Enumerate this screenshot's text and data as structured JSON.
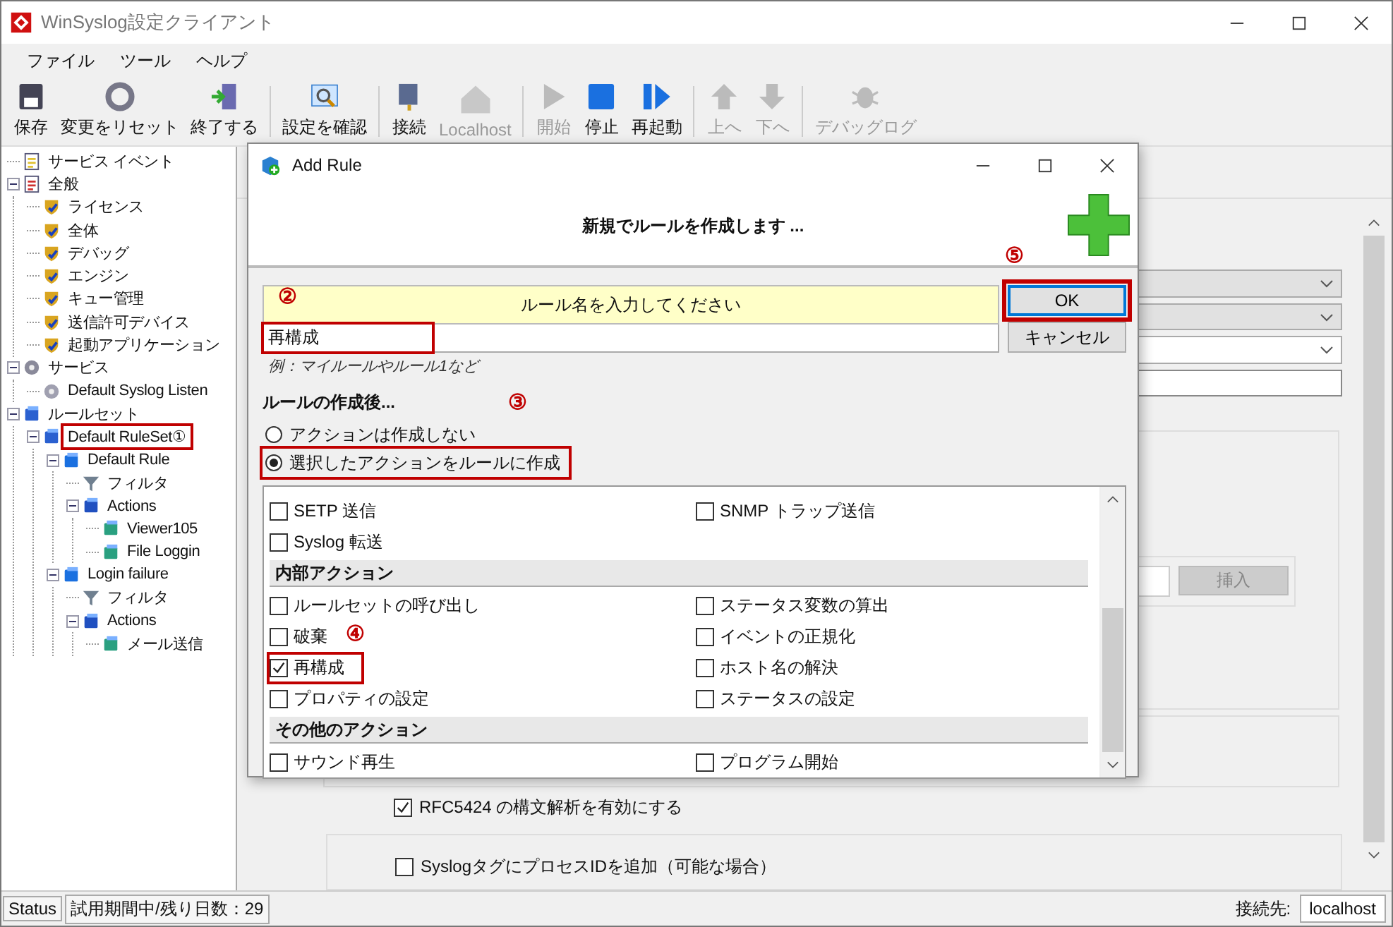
{
  "window": {
    "title": "WinSyslog設定クライアント"
  },
  "menu": [
    "ファイル",
    "ツール",
    "ヘルプ"
  ],
  "toolbar": [
    {
      "buttons": [
        {
          "label": "保存",
          "disabled": false
        },
        {
          "label": "変更をリセット",
          "disabled": false
        },
        {
          "label": "終了する",
          "disabled": false
        }
      ]
    },
    {
      "buttons": [
        {
          "label": "設定を確認",
          "disabled": false
        }
      ]
    },
    {
      "buttons": [
        {
          "label": "接続",
          "disabled": false
        },
        {
          "label": "Localhost",
          "disabled": true
        }
      ]
    },
    {
      "buttons": [
        {
          "label": "開始",
          "disabled": true
        },
        {
          "label": "停止",
          "disabled": false
        },
        {
          "label": "再起動",
          "disabled": false
        }
      ]
    },
    {
      "buttons": [
        {
          "label": "上へ",
          "disabled": true
        },
        {
          "label": "下へ",
          "disabled": true
        }
      ]
    },
    {
      "buttons": [
        {
          "label": "デバッグログ",
          "disabled": true
        }
      ]
    }
  ],
  "tree": [
    {
      "label": "サービス イベント",
      "kind": "event"
    },
    {
      "label": "全般",
      "kind": "general",
      "expanded": true,
      "children": [
        {
          "label": "ライセンス",
          "kind": "setting"
        },
        {
          "label": "全体",
          "kind": "setting"
        },
        {
          "label": "デバッグ",
          "kind": "setting"
        },
        {
          "label": "エンジン",
          "kind": "setting"
        },
        {
          "label": "キュー管理",
          "kind": "setting"
        },
        {
          "label": "送信許可デバイス",
          "kind": "setting"
        },
        {
          "label": "起動アプリケーション",
          "kind": "setting"
        }
      ]
    },
    {
      "label": "サービス",
      "kind": "service",
      "expanded": true,
      "children": [
        {
          "label": "Default Syslog Listen",
          "kind": "listener"
        }
      ]
    },
    {
      "label": "ルールセット",
      "kind": "ruleset",
      "expanded": true,
      "children": [
        {
          "label": "Default RuleSet",
          "kind": "ruleset",
          "expanded": true,
          "highlighted": true,
          "marker": "①",
          "children": [
            {
              "label": "Default Rule",
              "kind": "rule",
              "expanded": true,
              "children": [
                {
                  "label": "フィルタ",
                  "kind": "filter"
                },
                {
                  "label": "Actions",
                  "kind": "actions",
                  "expanded": true,
                  "children": [
                    {
                      "label": "Viewer105",
                      "kind": "action"
                    },
                    {
                      "label": "File Loggin",
                      "kind": "action"
                    }
                  ]
                }
              ]
            },
            {
              "label": "Login failure",
              "kind": "rule",
              "expanded": true,
              "children": [
                {
                  "label": "フィルタ",
                  "kind": "filter"
                },
                {
                  "label": "Actions",
                  "kind": "actions",
                  "expanded": true,
                  "children": [
                    {
                      "label": "メール送信",
                      "kind": "action"
                    }
                  ]
                }
              ]
            }
          ]
        }
      ]
    }
  ],
  "side_panel": {
    "insert_button": "挿入",
    "checkboxes": [
      {
        "label": "RFC5424 の構文解析を有効にする",
        "checked": true
      },
      {
        "label": "SyslogタグにプロセスIDを追加（可能な場合）",
        "checked": false
      }
    ]
  },
  "dialog": {
    "title": "Add Rule",
    "heading": "新規でルールを作成します ...",
    "name_label": "ルール名を入力してください",
    "name_field": {
      "value": "再構成",
      "highlighted": true,
      "marker": "②"
    },
    "hint": "例：マイルールやルール1など",
    "after_label": "ルールの作成後...",
    "radios": [
      {
        "label": "アクションは作成しない",
        "selected": false,
        "highlighted": false
      },
      {
        "label": "選択したアクションをルールに作成",
        "selected": true,
        "highlighted": true,
        "marker": "③"
      }
    ],
    "buttons": [
      {
        "label": "OK",
        "default": true,
        "highlighted": true,
        "marker": "⑤"
      },
      {
        "label": "キャンセル",
        "default": false,
        "highlighted": false
      }
    ],
    "action_groups": [
      {
        "items": [
          {
            "label": "SETP 送信",
            "checked": false
          },
          {
            "label": "Syslog 転送",
            "checked": false
          },
          {
            "label": "SNMP トラップ送信",
            "checked": false
          }
        ]
      },
      {
        "title": "内部アクション",
        "items": [
          {
            "label": "ルールセットの呼び出し",
            "checked": false
          },
          {
            "label": "破棄",
            "checked": false
          },
          {
            "label": "再構成",
            "checked": true,
            "highlighted": true,
            "marker": "④"
          },
          {
            "label": "プロパティの設定",
            "checked": false
          },
          {
            "label": "ステータス変数の算出",
            "checked": false
          },
          {
            "label": "イベントの正規化",
            "checked": false
          },
          {
            "label": "ホスト名の解決",
            "checked": false
          },
          {
            "label": "ステータスの設定",
            "checked": false
          }
        ]
      },
      {
        "title": "その他のアクション",
        "items": [
          {
            "label": "サウンド再生",
            "checked": false
          },
          {
            "label": "プログラム開始",
            "checked": false
          }
        ]
      }
    ]
  },
  "status_bar": {
    "status": "Status",
    "trial": "試用期間中/残り日数：29",
    "connection_label": "接続先:",
    "host": "localhost"
  }
}
